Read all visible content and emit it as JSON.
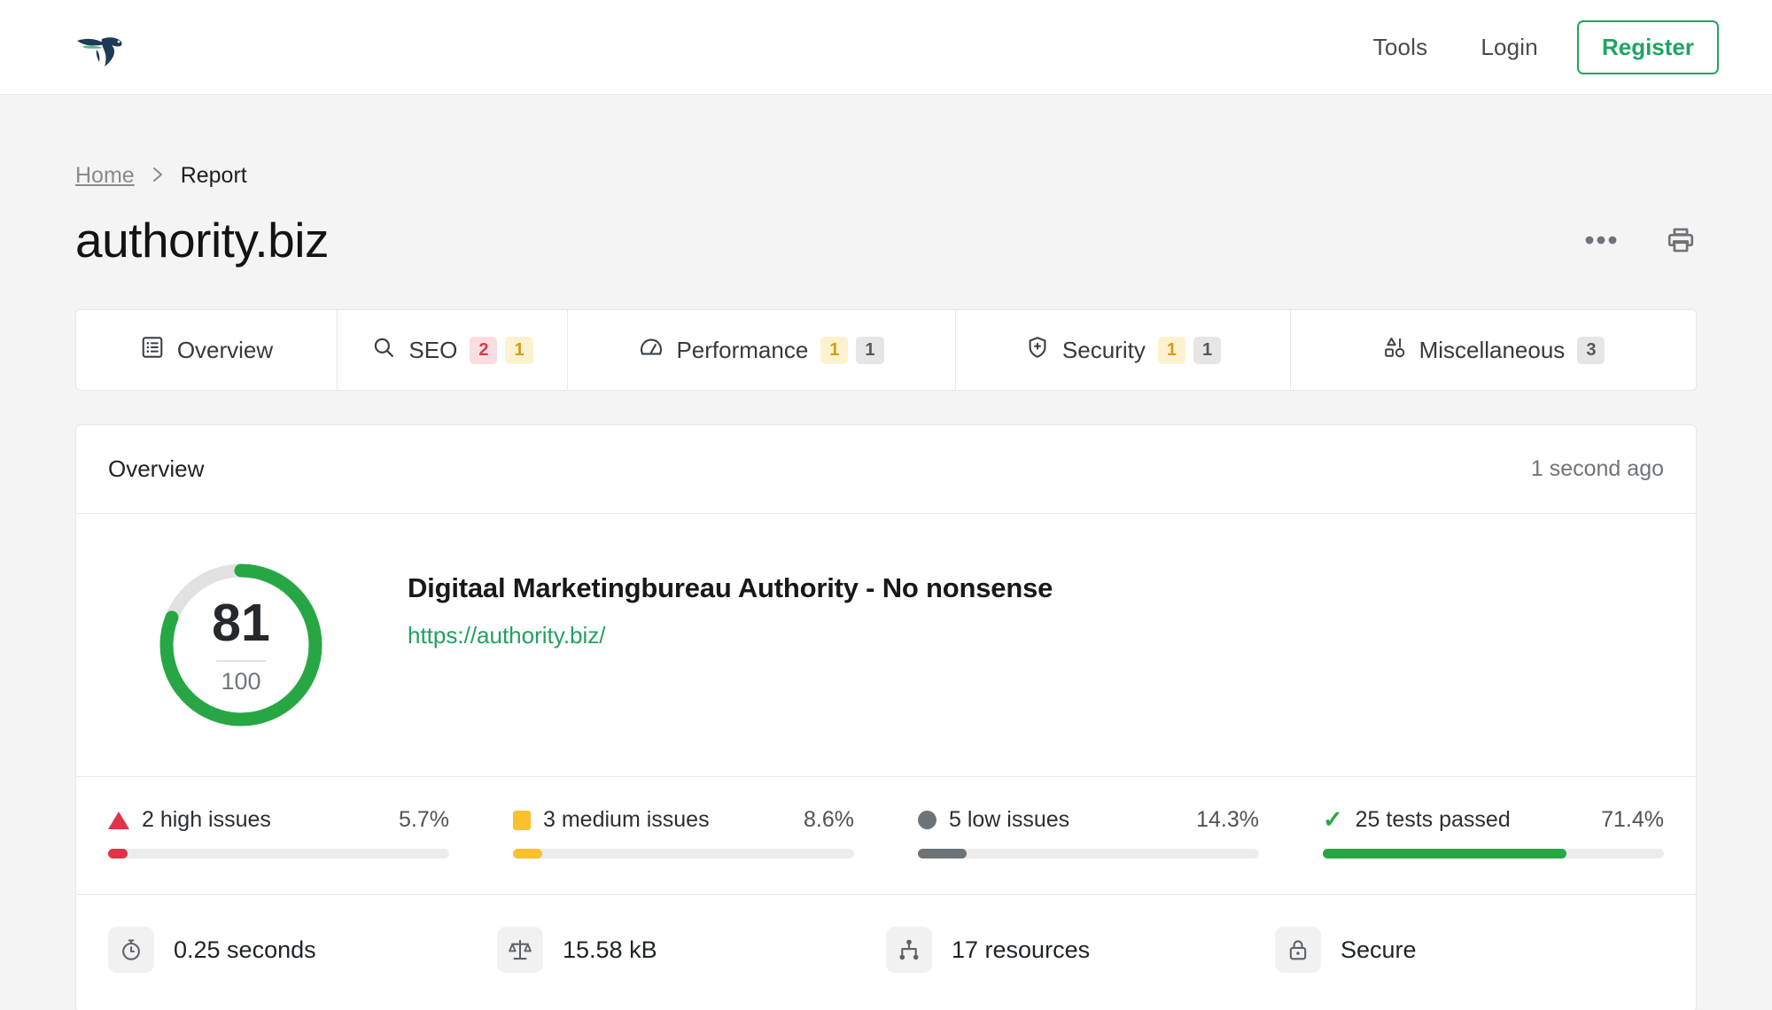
{
  "header": {
    "logo_name": "falcon-logo",
    "nav": [
      {
        "label": "Tools",
        "name": "nav-link-tools"
      },
      {
        "label": "Login",
        "name": "nav-link-login"
      }
    ],
    "register_label": "Register",
    "brand_green": "#27a35f"
  },
  "breadcrumb": {
    "home": "Home",
    "separator": "›",
    "current": "Report"
  },
  "page_title": "authority.biz",
  "title_actions": {
    "more": "more-options-icon",
    "print": "print-icon"
  },
  "tabs": [
    {
      "label": "Overview",
      "icon": "list-icon",
      "badges": []
    },
    {
      "label": "SEO",
      "icon": "search-icon",
      "badges": [
        {
          "value": "2",
          "level": "high"
        },
        {
          "value": "1",
          "level": "medium"
        }
      ]
    },
    {
      "label": "Performance",
      "icon": "gauge-icon",
      "badges": [
        {
          "value": "1",
          "level": "medium"
        },
        {
          "value": "1",
          "level": "low"
        }
      ]
    },
    {
      "label": "Security",
      "icon": "shield-icon",
      "badges": [
        {
          "value": "1",
          "level": "medium"
        },
        {
          "value": "1",
          "level": "low"
        }
      ]
    },
    {
      "label": "Miscellaneous",
      "icon": "shapes-icon",
      "badges": [
        {
          "value": "3",
          "level": "low"
        }
      ]
    }
  ],
  "overview": {
    "panel_title": "Overview",
    "timestamp": "1 second ago",
    "score": "81",
    "score_max": "100",
    "score_pct": 81,
    "score_color": "#27a744",
    "track_color": "#e1e1e1",
    "site_title": "Digitaal Marketingbureau Authority - No nonsense",
    "site_url": "https://authority.biz/"
  },
  "issues": [
    {
      "label": "2 high issues",
      "pct": "5.7%",
      "fill": 5.7,
      "color": "#e03347",
      "marker": "triangle-icon"
    },
    {
      "label": "3 medium issues",
      "pct": "8.6%",
      "fill": 8.6,
      "color": "#fbc02d",
      "marker": "square-icon"
    },
    {
      "label": "5 low issues",
      "pct": "14.3%",
      "fill": 14.3,
      "color": "#6e7378",
      "marker": "circle-icon"
    },
    {
      "label": "25 tests passed",
      "pct": "71.4%",
      "fill": 71.4,
      "color": "#27a744",
      "marker": "check-icon"
    }
  ],
  "stats": [
    {
      "label": "0.25 seconds",
      "icon": "stopwatch-icon"
    },
    {
      "label": "15.58 kB",
      "icon": "scales-icon"
    },
    {
      "label": "17 resources",
      "icon": "sitemap-icon"
    },
    {
      "label": "Secure",
      "icon": "lock-icon"
    }
  ]
}
